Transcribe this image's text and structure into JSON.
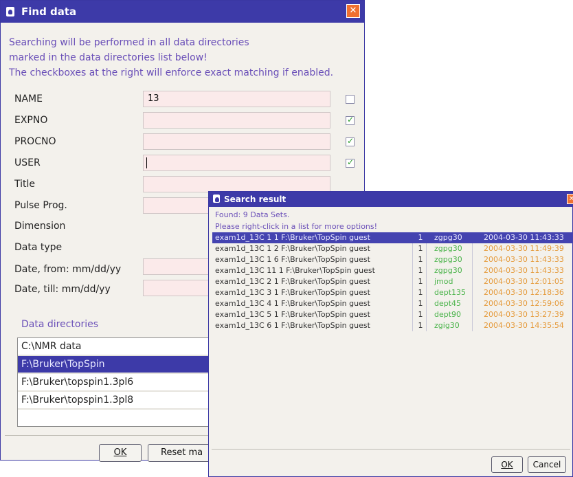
{
  "find": {
    "title": "Find data",
    "close_glyph": "✕",
    "info": [
      "Searching will be performed in all data directories",
      "marked in the data directories list below!",
      "The checkboxes at the right will enforce exact matching if enabled."
    ],
    "fields": [
      {
        "label": "NAME",
        "value": "13",
        "exact": false
      },
      {
        "label": "EXPNO",
        "value": "",
        "exact": true
      },
      {
        "label": "PROCNO",
        "value": "",
        "exact": true
      },
      {
        "label": "USER",
        "value": "",
        "exact": true
      },
      {
        "label": "Title",
        "value": ""
      },
      {
        "label": "Pulse Prog.",
        "value": ""
      },
      {
        "label": "Dimension"
      },
      {
        "label": "Data type"
      },
      {
        "label": "Date, from: mm/dd/yy",
        "value": ""
      },
      {
        "label": "Date, till: mm/dd/yy",
        "value": ""
      }
    ],
    "dirs_title": "Data directories",
    "dirs": [
      "C:\\NMR data",
      "F:\\Bruker\\TopSpin",
      "F:\\Bruker\\topspin1.3pl6",
      "F:\\Bruker\\topspin1.3pl8"
    ],
    "dirs_selected": 1,
    "ok_label": "OK",
    "reset_label": "Reset ma"
  },
  "result": {
    "title": "Search result",
    "found": "Found: 9 Data Sets.",
    "hint": "Please right-click in a list for more options!",
    "rows": [
      [
        "exam1d_13C  1  1  F:\\Bruker\\TopSpin  guest",
        "1",
        "zgpg30",
        "2004-03-30 11:43:33"
      ],
      [
        "exam1d_13C  1  2  F:\\Bruker\\TopSpin  guest",
        "1",
        "zgpg30",
        "2004-03-30 11:49:39"
      ],
      [
        "exam1d_13C  1  6  F:\\Bruker\\TopSpin  guest",
        "1",
        "zgpg30",
        "2004-03-30 11:43:33"
      ],
      [
        "exam1d_13C  11  1  F:\\Bruker\\TopSpin  guest",
        "1",
        "zgpg30",
        "2004-03-30 11:43:33"
      ],
      [
        "exam1d_13C  2  1  F:\\Bruker\\TopSpin  guest",
        "1",
        "jmod",
        "2004-03-30 12:01:05"
      ],
      [
        "exam1d_13C  3  1  F:\\Bruker\\TopSpin  guest",
        "1",
        "dept135",
        "2004-03-30 12:18:36"
      ],
      [
        "exam1d_13C  4  1  F:\\Bruker\\TopSpin  guest",
        "1",
        "dept45",
        "2004-03-30 12:59:06"
      ],
      [
        "exam1d_13C  5  1  F:\\Bruker\\TopSpin  guest",
        "1",
        "dept90",
        "2004-03-30 13:27:39"
      ],
      [
        "exam1d_13C  6  1  F:\\Bruker\\TopSpin  guest",
        "1",
        "zgig30",
        "2004-03-30 14:35:54"
      ]
    ],
    "selected_row": 0,
    "ok_label": "OK",
    "cancel_label": "Cancel"
  },
  "colors": {
    "title_bar": "#3d3aa8",
    "selection": "#3d3aa8",
    "info_text": "#6a4fb8",
    "close_button": "#f07030",
    "pulse_program": "#49b349",
    "date": "#e59a3a"
  }
}
